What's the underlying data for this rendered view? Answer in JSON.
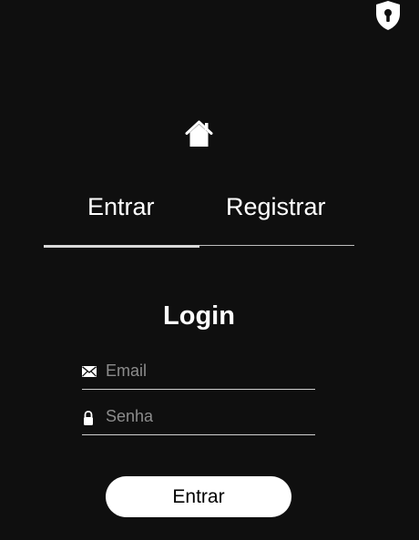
{
  "header": {
    "shield_icon": "shield-keyhole-icon",
    "home_icon": "home-icon"
  },
  "tabs": {
    "items": [
      {
        "label": "Entrar",
        "active": true
      },
      {
        "label": "Registrar",
        "active": false
      }
    ]
  },
  "login": {
    "title": "Login",
    "email": {
      "icon": "envelope-icon",
      "placeholder": "Email",
      "value": ""
    },
    "password": {
      "icon": "lock-icon",
      "placeholder": "Senha",
      "value": ""
    },
    "submit_label": "Entrar"
  },
  "colors": {
    "background": "#0f0f0f",
    "text": "#ffffff",
    "button_bg": "#ffffff",
    "button_text": "#000000",
    "placeholder": "#8c8c8c"
  }
}
